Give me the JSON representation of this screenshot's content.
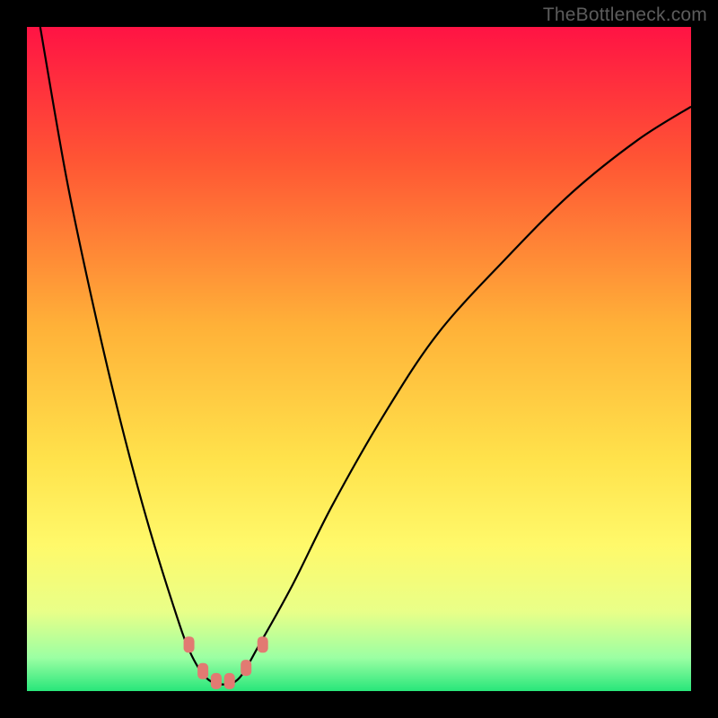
{
  "watermark": "TheBottleneck.com",
  "chart_data": {
    "type": "line",
    "title": "",
    "xlabel": "",
    "ylabel": "",
    "xlim": [
      0,
      1
    ],
    "ylim": [
      0,
      100
    ],
    "series": [
      {
        "name": "bottleneck-curve",
        "x": [
          0.02,
          0.06,
          0.1,
          0.14,
          0.18,
          0.22,
          0.245,
          0.27,
          0.295,
          0.32,
          0.35,
          0.4,
          0.46,
          0.54,
          0.62,
          0.72,
          0.82,
          0.92,
          1.0
        ],
        "y": [
          100,
          77,
          58,
          41,
          26,
          13,
          6,
          2,
          1,
          2,
          7,
          16,
          28,
          42,
          54,
          65,
          75,
          83,
          88
        ]
      }
    ],
    "gradient_stops": [
      {
        "offset": 0.0,
        "color": "#ff1344"
      },
      {
        "offset": 0.2,
        "color": "#ff5534"
      },
      {
        "offset": 0.45,
        "color": "#ffb138"
      },
      {
        "offset": 0.65,
        "color": "#ffe24b"
      },
      {
        "offset": 0.78,
        "color": "#fff96a"
      },
      {
        "offset": 0.88,
        "color": "#e9ff88"
      },
      {
        "offset": 0.95,
        "color": "#9bffa3"
      },
      {
        "offset": 1.0,
        "color": "#28e67a"
      }
    ],
    "markers": [
      {
        "x": 0.244,
        "y": 7.0
      },
      {
        "x": 0.265,
        "y": 3.0
      },
      {
        "x": 0.285,
        "y": 1.5
      },
      {
        "x": 0.305,
        "y": 1.5
      },
      {
        "x": 0.33,
        "y": 3.5
      },
      {
        "x": 0.355,
        "y": 7.0
      }
    ],
    "marker_color": "#e27a72"
  }
}
